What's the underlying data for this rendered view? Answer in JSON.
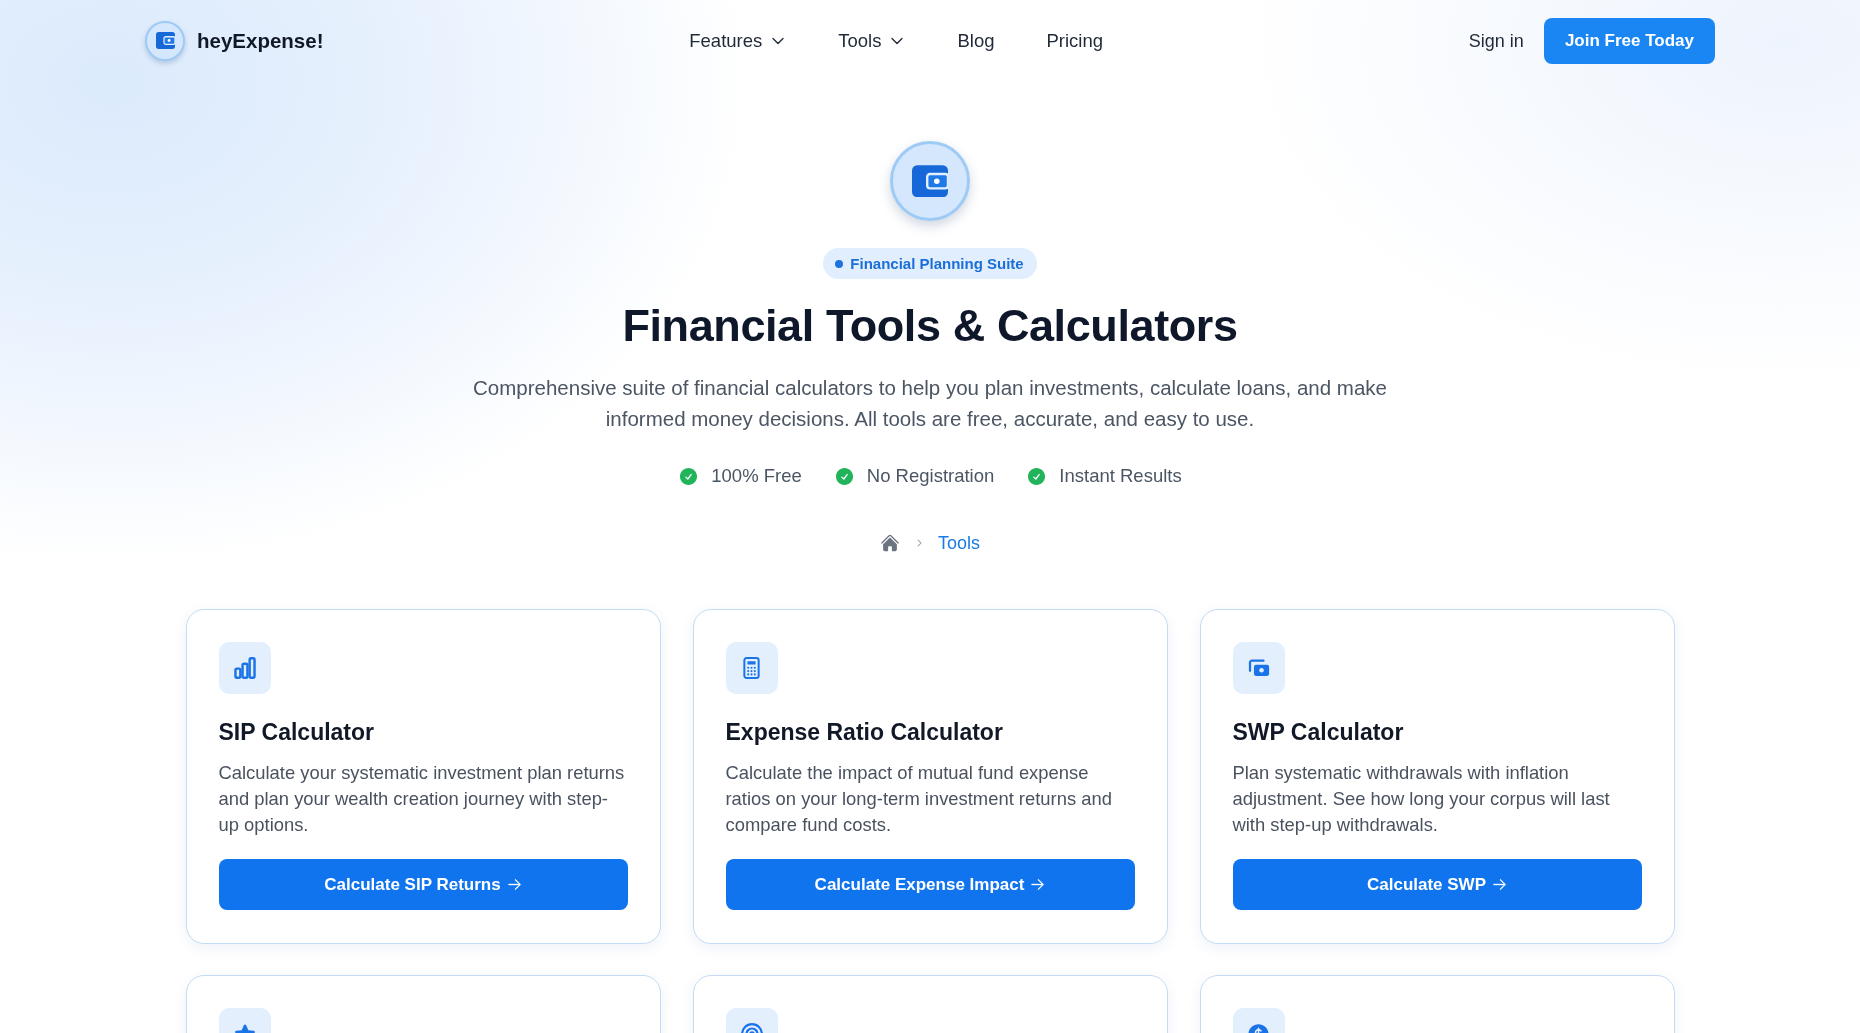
{
  "header": {
    "brand": "heyExpense!",
    "nav": [
      {
        "label": "Features",
        "has_menu": true
      },
      {
        "label": "Tools",
        "has_menu": true
      },
      {
        "label": "Blog",
        "has_menu": false
      },
      {
        "label": "Pricing",
        "has_menu": false
      }
    ],
    "sign_in": "Sign in",
    "cta": "Join Free Today"
  },
  "hero": {
    "badge": "Financial Planning Suite",
    "title": "Financial Tools & Calculators",
    "description": "Comprehensive suite of financial calculators to help you plan investments, calculate loans, and make informed money decisions. All tools are free, accurate, and easy to use.",
    "highlights": [
      "100% Free",
      "No Registration",
      "Instant Results"
    ]
  },
  "breadcrumb": {
    "current": "Tools"
  },
  "tools": [
    {
      "kind": "chart",
      "title": "SIP Calculator",
      "description": "Calculate your systematic investment plan returns and plan your wealth creation journey with step-up options.",
      "button": "Calculate SIP Returns"
    },
    {
      "kind": "calculator",
      "title": "Expense Ratio Calculator",
      "description": "Calculate the impact of mutual fund expense ratios on your long-term investment returns and compare fund costs.",
      "button": "Calculate Expense Impact"
    },
    {
      "kind": "cash",
      "title": "SWP Calculator",
      "description": "Plan systematic withdrawals with inflation adjustment. See how long your corpus will last with step-up withdrawals.",
      "button": "Calculate SWP"
    },
    {
      "kind": "star"
    },
    {
      "kind": "target"
    },
    {
      "kind": "coin"
    }
  ]
}
